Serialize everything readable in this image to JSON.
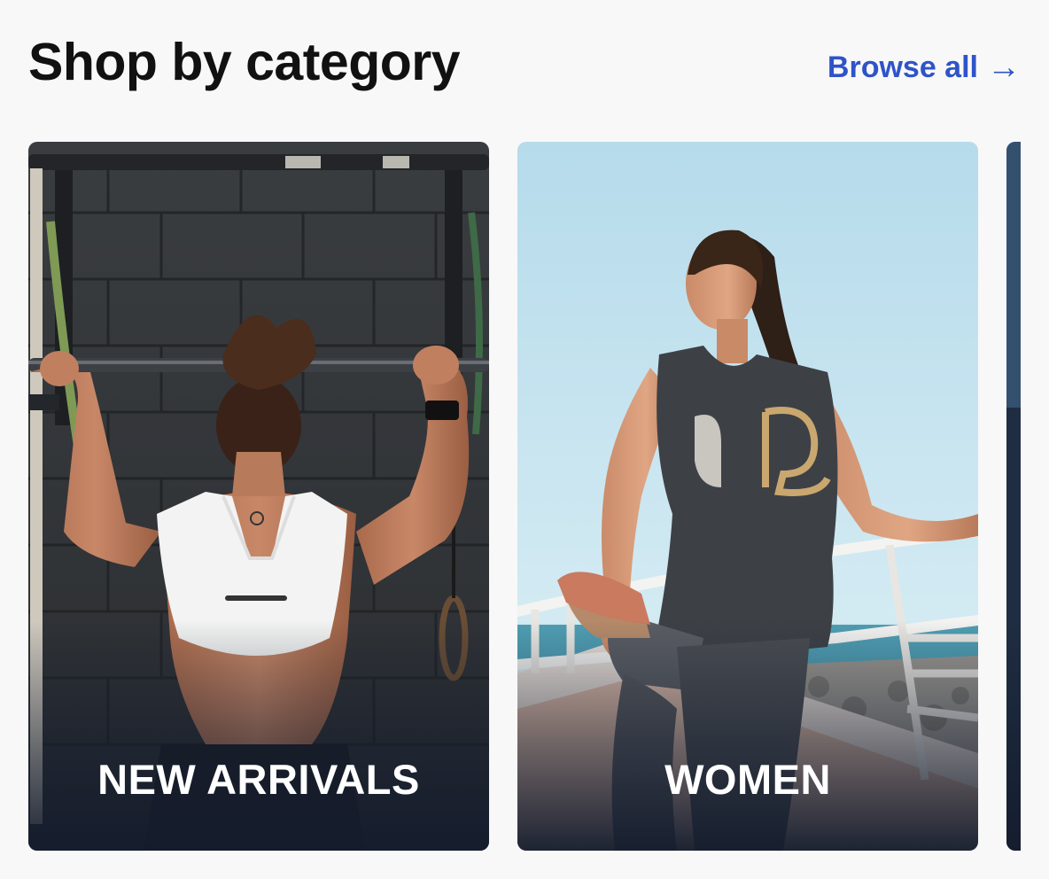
{
  "section": {
    "title": "Shop by category",
    "browse_label": "Browse all",
    "browse_arrow": "→"
  },
  "categories": [
    {
      "label": "NEW ARRIVALS",
      "image": "woman-doing-pull-up-in-gym-photo"
    },
    {
      "label": "WOMEN",
      "image": "woman-stretching-by-seaside-photo"
    },
    {
      "label": "",
      "image": "partially-visible-category-photo"
    }
  ],
  "colors": {
    "background": "#f8f8f8",
    "title": "#111111",
    "link": "#2f54c8",
    "card_label": "#ffffff"
  }
}
